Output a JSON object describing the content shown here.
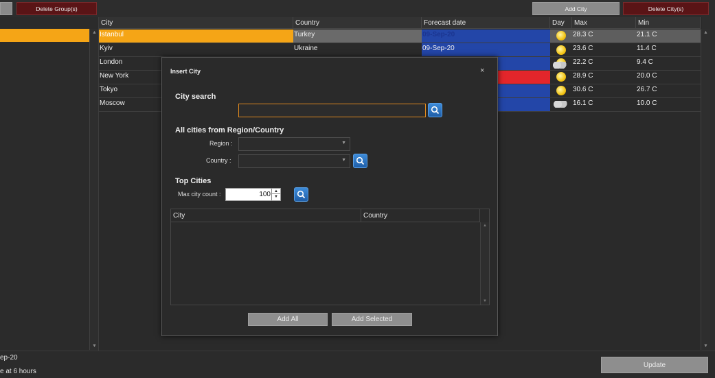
{
  "toolbar": {
    "delete_groups_label": "Delete Group(s)",
    "add_city_label": "Add City",
    "delete_cities_label": "Delete City(s)"
  },
  "grid": {
    "columns": [
      "City",
      "Country",
      "Forecast date",
      "Day",
      "Max",
      "Min"
    ],
    "rows": [
      {
        "city": "Istanbul",
        "country": "Turkey",
        "date": "09-Sep-20",
        "day_icon": "sun-icon",
        "max": "28.3 C",
        "min": "21.1 C",
        "selected": true
      },
      {
        "city": "Kyiv",
        "country": "Ukraine",
        "date": "09-Sep-20",
        "day_icon": "sun-icon",
        "max": "23.6 C",
        "min": "11.4 C"
      },
      {
        "city": "London",
        "country": "",
        "date": "",
        "day_icon": "cloud-sun-icon",
        "max": "22.2 C",
        "min": "9.4 C"
      },
      {
        "city": "New York",
        "country": "",
        "date": "",
        "day_icon": "sun-icon",
        "max": "28.9 C",
        "min": "20.0 C"
      },
      {
        "city": "Tokyo",
        "country": "",
        "date": "",
        "day_icon": "sun-icon",
        "max": "30.6 C",
        "min": "26.7 C"
      },
      {
        "city": "Moscow",
        "country": "",
        "date": "",
        "day_icon": "cloud-icon",
        "max": "16.1 C",
        "min": "10.0 C"
      }
    ],
    "colors": {
      "selected_row": "#f5a516",
      "date_cell": "#2346a8",
      "highlight_red": "#e3262b"
    }
  },
  "status": {
    "line1": "ep-20",
    "line2": "e at 6 hours",
    "update_label": "Update"
  },
  "dialog": {
    "title": "Insert City",
    "city_search_title": "City search",
    "city_search_value": "",
    "region_section_title": "All cities from Region/Country",
    "region_label": "Region :",
    "country_label": "Country :",
    "region_value": "",
    "country_value": "",
    "top_cities_title": "Top Cities",
    "max_city_count_label": "Max city count :",
    "max_city_count_value": "100",
    "results_columns": [
      "City",
      "Country"
    ],
    "add_all_label": "Add All",
    "add_selected_label": "Add Selected",
    "accent": "#e08a1e"
  }
}
